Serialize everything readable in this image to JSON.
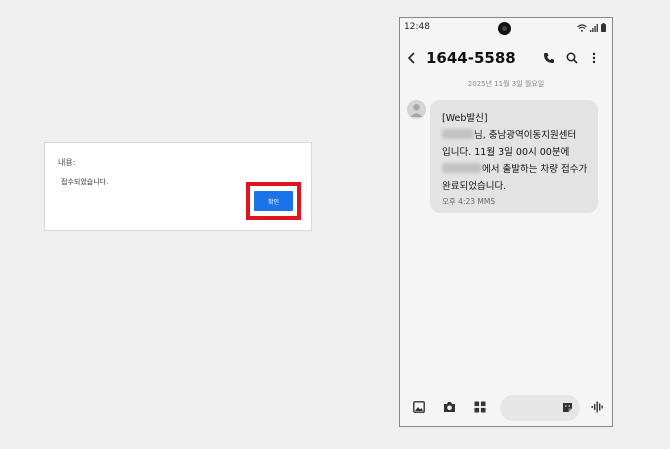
{
  "dialog": {
    "title": "내용:",
    "message": "접수되었습니다.",
    "confirm_label": "확인",
    "highlight_color": "#e0141e",
    "button_color": "#1a73e8"
  },
  "phone": {
    "status_time": "12:48",
    "contact_number": "1644-5588",
    "date_label": "2025년 11월 3일 월요일",
    "message": {
      "line1": "[Web발신]",
      "line2_suffix": "님, 충남광역이동지원센터",
      "line3": "입니다. 11월 3일 00시 00분에",
      "line4_suffix": "에서 출발하는 차량 접수가",
      "line5": "완료되었습니다.",
      "meta": "오후 4:23 MMS"
    },
    "icons": [
      "wifi-icon",
      "signal-icon",
      "battery-icon",
      "back-arrow-icon",
      "phone-icon",
      "search-icon",
      "more-icon",
      "gallery-icon",
      "camera-icon",
      "apps-icon",
      "sticker-icon",
      "voice-icon"
    ]
  }
}
